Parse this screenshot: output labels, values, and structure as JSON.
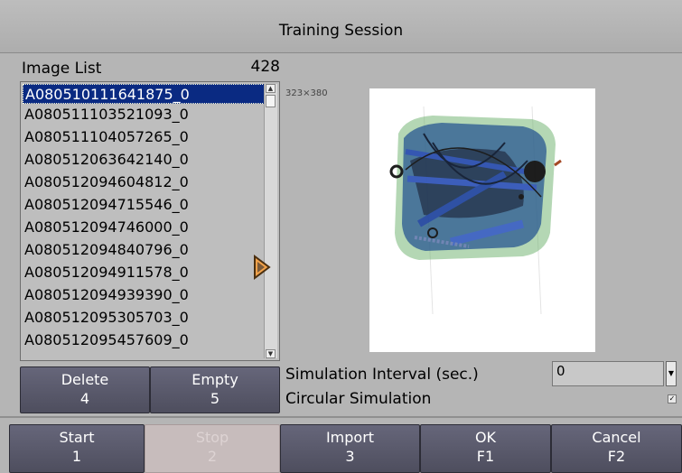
{
  "window": {
    "title": "Training Session"
  },
  "image_list": {
    "label": "Image List",
    "count": "428",
    "selected_index": 0,
    "items": [
      "A080510111641875_0",
      "A080511103521093_0",
      "A080511104057265_0",
      "A080512063642140_0",
      "A080512094604812_0",
      "A080512094715546_0",
      "A080512094746000_0",
      "A080512094840796_0",
      "A080512094911578_0",
      "A080512094939390_0",
      "A080512095305703_0",
      "A080512095457609_0"
    ]
  },
  "preview": {
    "dimensions": "323×380"
  },
  "list_buttons": {
    "delete": {
      "label": "Delete",
      "key": "4"
    },
    "empty": {
      "label": "Empty",
      "key": "5"
    }
  },
  "simulation": {
    "interval_label": "Simulation Interval (sec.)",
    "interval_value": "0",
    "circular_label": "Circular Simulation",
    "circular_checked": true
  },
  "bottom_buttons": {
    "start": {
      "label": "Start",
      "key": "1"
    },
    "stop": {
      "label": "Stop",
      "key": "2"
    },
    "import": {
      "label": "Import",
      "key": "3"
    },
    "ok": {
      "label": "OK",
      "key": "F1"
    },
    "cancel": {
      "label": "Cancel",
      "key": "F2"
    }
  },
  "colors": {
    "selection": "#0a2a82",
    "button": "#5a5a6a",
    "disabled_button": "#c7bcbc"
  }
}
